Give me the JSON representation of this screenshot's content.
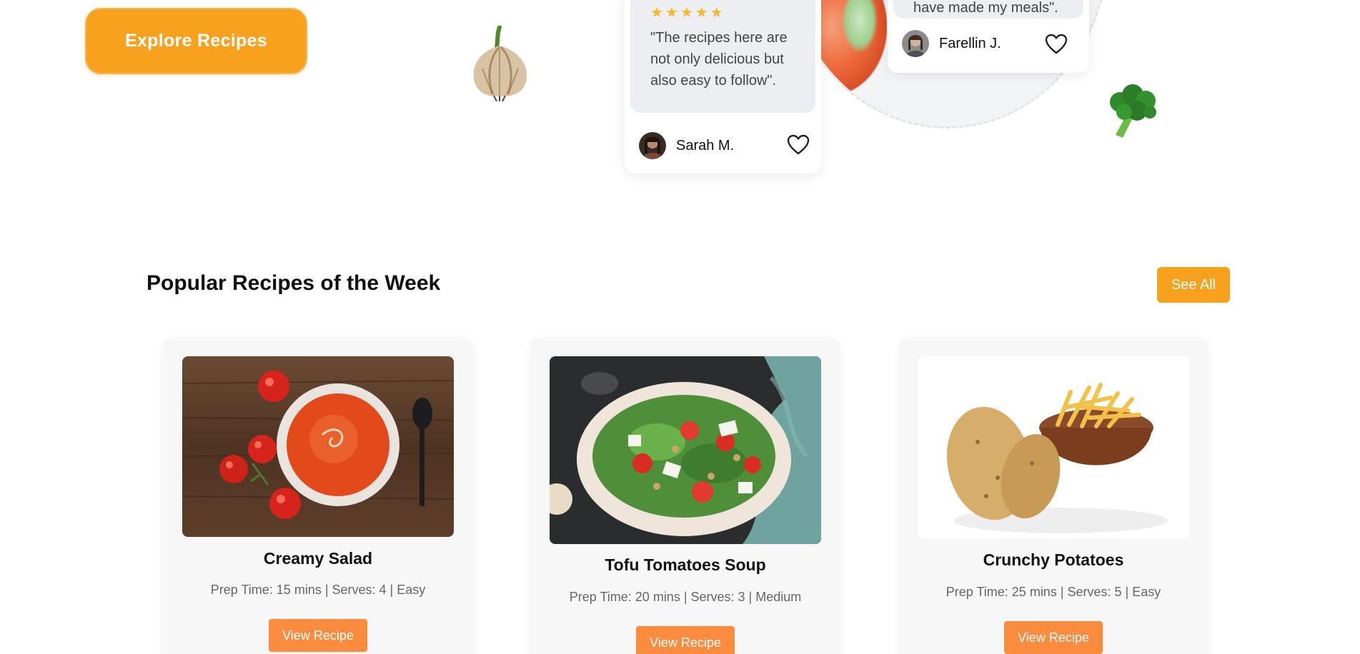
{
  "hero": {
    "cta_label": "Explore Recipes"
  },
  "testimonials": [
    {
      "stars": "★★★★★",
      "quote": "\"The recipes here are not only delicious but also easy to follow\".",
      "name": "Sarah M."
    },
    {
      "quote": "have made my meals\".",
      "name": "Farellin J."
    }
  ],
  "popular": {
    "title": "Popular Recipes of the Week",
    "see_all_label": "See All",
    "recipes": [
      {
        "title": "Creamy Salad",
        "meta": "Prep Time: 15 mins | Serves: 4 | Easy",
        "button": "View Recipe"
      },
      {
        "title": "Tofu Tomatoes Soup",
        "meta": "Prep Time: 20 mins | Serves: 3 | Medium",
        "button": "View Recipe"
      },
      {
        "title": "Crunchy Potatoes",
        "meta": "Prep Time: 25 mins | Serves: 5 | Easy",
        "button": "View Recipe"
      }
    ]
  },
  "colors": {
    "accent": "#f7a11e",
    "button_orange": "#fb8c3f",
    "star": "#f7b731"
  },
  "icons": [
    "heart-icon",
    "garlic-icon",
    "broccoli-icon"
  ]
}
